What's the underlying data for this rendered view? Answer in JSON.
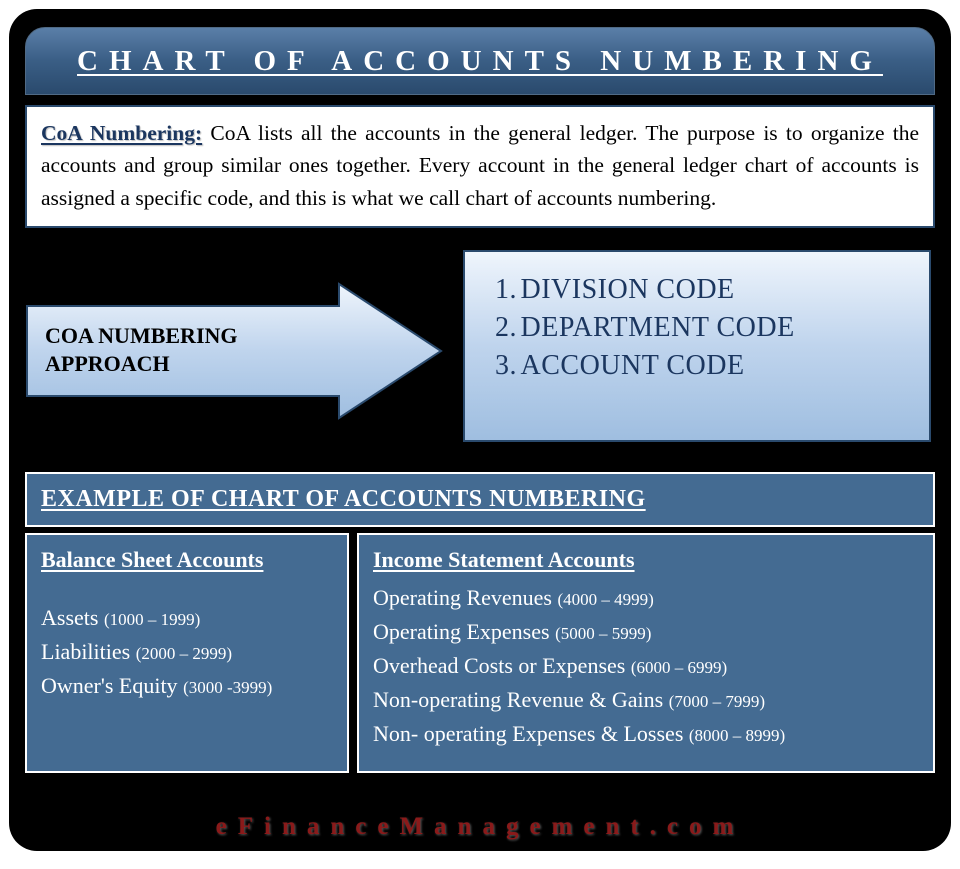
{
  "title": "CHART OF ACCOUNTS NUMBERING",
  "description": {
    "lead": "CoA Numbering:",
    "body": " CoA lists all the accounts in the general ledger. The purpose is to organize the accounts and group similar ones together. Every account in the general ledger chart of accounts is assigned a specific code, and this is what we call chart of accounts numbering."
  },
  "approach": {
    "label_line1": "COA NUMBERING",
    "label_line2": "APPROACH",
    "codes": [
      "DIVISION CODE",
      "DEPARTMENT CODE",
      "ACCOUNT CODE"
    ]
  },
  "example": {
    "header": "EXAMPLE OF CHART OF ACCOUNTS NUMBERING",
    "balance_sheet": {
      "title": "Balance Sheet Accounts",
      "items": [
        {
          "name": "Assets",
          "range": "(1000 – 1999)"
        },
        {
          "name": "Liabilities",
          "range": "(2000 – 2999)"
        },
        {
          "name": "Owner's Equity",
          "range": "(3000 -3999)"
        }
      ]
    },
    "income_statement": {
      "title": "Income Statement Accounts ",
      "items": [
        {
          "name": "Operating Revenues",
          "range": "(4000 – 4999)"
        },
        {
          "name": "Operating Expenses",
          "range": "(5000 – 5999)"
        },
        {
          "name": "Overhead Costs or Expenses",
          "range": "(6000 – 6999)"
        },
        {
          "name": "Non-operating Revenue & Gains",
          "range": "(7000 – 7999)"
        },
        {
          "name": "Non- operating Expenses & Losses",
          "range": "(8000 – 8999)"
        }
      ]
    }
  },
  "footer": "eFinanceManagement.com",
  "colors": {
    "panel_blue": "#446b92",
    "dark_navy": "#1b365f",
    "brand_red": "#8a1a1a"
  }
}
